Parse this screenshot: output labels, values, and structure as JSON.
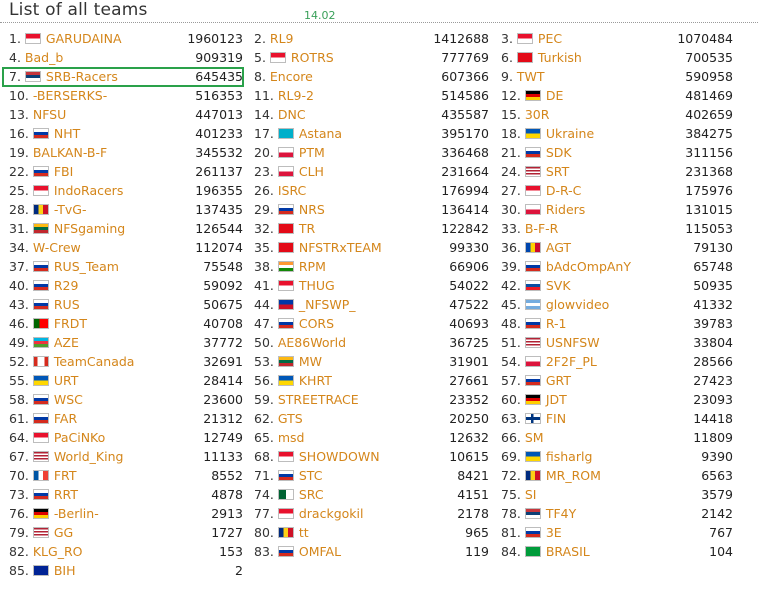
{
  "page": {
    "title": "List of all teams",
    "date": "14.02"
  },
  "colors": {
    "link": "#d4861b",
    "highlight": "#2aa14a",
    "date": "#3aa05a"
  },
  "teams": [
    {
      "rank": "1.",
      "name": "GARUDAINA",
      "score": "1960123",
      "flag": "flag-id"
    },
    {
      "rank": "2.",
      "name": "RL9",
      "score": "1412688",
      "flag": "none"
    },
    {
      "rank": "3.",
      "name": "PEC",
      "score": "1070484",
      "flag": "flag-id"
    },
    {
      "rank": "4.",
      "name": "Bad_b",
      "score": "909319",
      "flag": "none"
    },
    {
      "rank": "5.",
      "name": "ROTRS",
      "score": "777769",
      "flag": "flag-id"
    },
    {
      "rank": "6.",
      "name": "Turkish",
      "score": "700535",
      "flag": "flag-tr"
    },
    {
      "rank": "7.",
      "name": "SRB-Racers",
      "score": "645435",
      "flag": "flag-rs"
    },
    {
      "rank": "8.",
      "name": "Encore",
      "score": "607366",
      "flag": "none"
    },
    {
      "rank": "9.",
      "name": "TWT",
      "score": "590958",
      "flag": "none"
    },
    {
      "rank": "10.",
      "name": "-BERSERKS-",
      "score": "516353",
      "flag": "none"
    },
    {
      "rank": "11.",
      "name": "RL9-2",
      "score": "514586",
      "flag": "none"
    },
    {
      "rank": "12.",
      "name": "DE",
      "score": "481469",
      "flag": "flag-de"
    },
    {
      "rank": "13.",
      "name": "NFSU",
      "score": "447013",
      "flag": "none"
    },
    {
      "rank": "14.",
      "name": "DNC",
      "score": "435587",
      "flag": "none"
    },
    {
      "rank": "15.",
      "name": "30R",
      "score": "402659",
      "flag": "none"
    },
    {
      "rank": "16.",
      "name": "NHT",
      "score": "401233",
      "flag": "flag-ru"
    },
    {
      "rank": "17.",
      "name": "Astana",
      "score": "395170",
      "flag": "flag-kz"
    },
    {
      "rank": "18.",
      "name": "Ukraine",
      "score": "384275",
      "flag": "flag-ua"
    },
    {
      "rank": "19.",
      "name": "BALKAN-B-F",
      "score": "345532",
      "flag": "none"
    },
    {
      "rank": "20.",
      "name": "PTM",
      "score": "336468",
      "flag": "flag-pl"
    },
    {
      "rank": "21.",
      "name": "SDK",
      "score": "311156",
      "flag": "flag-ru"
    },
    {
      "rank": "22.",
      "name": "FBI",
      "score": "261137",
      "flag": "flag-ru"
    },
    {
      "rank": "23.",
      "name": "CLH",
      "score": "231664",
      "flag": "flag-pl"
    },
    {
      "rank": "24.",
      "name": "SRT",
      "score": "231368",
      "flag": "flag-us"
    },
    {
      "rank": "25.",
      "name": "IndoRacers",
      "score": "196355",
      "flag": "flag-id"
    },
    {
      "rank": "26.",
      "name": "ISRC",
      "score": "176994",
      "flag": "none"
    },
    {
      "rank": "27.",
      "name": "D-R-C",
      "score": "175976",
      "flag": "flag-id"
    },
    {
      "rank": "28.",
      "name": "-TvG-",
      "score": "137435",
      "flag": "flag-ro"
    },
    {
      "rank": "29.",
      "name": "NRS",
      "score": "136414",
      "flag": "flag-ru"
    },
    {
      "rank": "30.",
      "name": "Riders",
      "score": "131015",
      "flag": "flag-pl"
    },
    {
      "rank": "31.",
      "name": "NFSgaming",
      "score": "126544",
      "flag": "flag-lt"
    },
    {
      "rank": "32.",
      "name": "TR",
      "score": "122842",
      "flag": "flag-tr"
    },
    {
      "rank": "33.",
      "name": "B-F-R",
      "score": "115053",
      "flag": "none"
    },
    {
      "rank": "34.",
      "name": "W-Crew",
      "score": "112074",
      "flag": "none"
    },
    {
      "rank": "35.",
      "name": "NFSTRxTEAM",
      "score": "99330",
      "flag": "flag-tr"
    },
    {
      "rank": "36.",
      "name": "AGT",
      "score": "79130",
      "flag": "flag-md"
    },
    {
      "rank": "37.",
      "name": "RUS_Team",
      "score": "75548",
      "flag": "flag-ru"
    },
    {
      "rank": "38.",
      "name": "RPM",
      "score": "66906",
      "flag": "flag-in"
    },
    {
      "rank": "39.",
      "name": "bAdcOmpAnY",
      "score": "65748",
      "flag": "flag-ru"
    },
    {
      "rank": "40.",
      "name": "R29",
      "score": "59092",
      "flag": "flag-ru"
    },
    {
      "rank": "41.",
      "name": "THUG",
      "score": "54022",
      "flag": "flag-id"
    },
    {
      "rank": "42.",
      "name": "SVK",
      "score": "50935",
      "flag": "flag-sk"
    },
    {
      "rank": "43.",
      "name": "RUS",
      "score": "50675",
      "flag": "flag-ru"
    },
    {
      "rank": "44.",
      "name": "_NFSWP_",
      "score": "47522",
      "flag": "flag-ph"
    },
    {
      "rank": "45.",
      "name": "glowvideo",
      "score": "41332",
      "flag": "flag-ar"
    },
    {
      "rank": "46.",
      "name": "FRDT",
      "score": "40708",
      "flag": "flag-pt"
    },
    {
      "rank": "47.",
      "name": "CORS",
      "score": "40693",
      "flag": "flag-ru"
    },
    {
      "rank": "48.",
      "name": "R-1",
      "score": "39783",
      "flag": "flag-ru"
    },
    {
      "rank": "49.",
      "name": "AZE",
      "score": "37772",
      "flag": "flag-az"
    },
    {
      "rank": "50.",
      "name": "AE86World",
      "score": "36725",
      "flag": "none"
    },
    {
      "rank": "51.",
      "name": "USNFSW",
      "score": "33804",
      "flag": "flag-us"
    },
    {
      "rank": "52.",
      "name": "TeamCanada",
      "score": "32691",
      "flag": "flag-ca"
    },
    {
      "rank": "53.",
      "name": "MW",
      "score": "31901",
      "flag": "flag-lt"
    },
    {
      "rank": "54.",
      "name": "2F2F_PL",
      "score": "28566",
      "flag": "flag-pl"
    },
    {
      "rank": "55.",
      "name": "URT",
      "score": "28414",
      "flag": "flag-ua"
    },
    {
      "rank": "56.",
      "name": "KHRT",
      "score": "27661",
      "flag": "flag-ua"
    },
    {
      "rank": "57.",
      "name": "GRT",
      "score": "27423",
      "flag": "flag-ru"
    },
    {
      "rank": "58.",
      "name": "WSC",
      "score": "23600",
      "flag": "flag-ru"
    },
    {
      "rank": "59.",
      "name": "STREETRACE",
      "score": "23352",
      "flag": "none"
    },
    {
      "rank": "60.",
      "name": "JDT",
      "score": "23093",
      "flag": "flag-de"
    },
    {
      "rank": "61.",
      "name": "FAR",
      "score": "21312",
      "flag": "flag-ru"
    },
    {
      "rank": "62.",
      "name": "GTS",
      "score": "20250",
      "flag": "none"
    },
    {
      "rank": "63.",
      "name": "FIN",
      "score": "14418",
      "flag": "flag-fi"
    },
    {
      "rank": "64.",
      "name": "PaCiNKo",
      "score": "12749",
      "flag": "flag-id"
    },
    {
      "rank": "65.",
      "name": "msd",
      "score": "12632",
      "flag": "none"
    },
    {
      "rank": "66.",
      "name": "SM",
      "score": "11809",
      "flag": "none"
    },
    {
      "rank": "67.",
      "name": "World_King",
      "score": "11133",
      "flag": "flag-us"
    },
    {
      "rank": "68.",
      "name": "SHOWDOWN",
      "score": "10615",
      "flag": "flag-id"
    },
    {
      "rank": "69.",
      "name": "fisharlg",
      "score": "9390",
      "flag": "flag-ua"
    },
    {
      "rank": "70.",
      "name": "FRT",
      "score": "8552",
      "flag": "flag-fr"
    },
    {
      "rank": "71.",
      "name": "STC",
      "score": "8421",
      "flag": "flag-ru"
    },
    {
      "rank": "72.",
      "name": "MR_ROM",
      "score": "6563",
      "flag": "flag-ro"
    },
    {
      "rank": "73.",
      "name": "RRT",
      "score": "4878",
      "flag": "flag-ru"
    },
    {
      "rank": "74.",
      "name": "SRC",
      "score": "4151",
      "flag": "flag-dz"
    },
    {
      "rank": "75.",
      "name": "SI",
      "score": "3579",
      "flag": "none"
    },
    {
      "rank": "76.",
      "name": "-Berlin-",
      "score": "2913",
      "flag": "flag-de"
    },
    {
      "rank": "77.",
      "name": "drackgokil",
      "score": "2178",
      "flag": "flag-id"
    },
    {
      "rank": "78.",
      "name": "TF4Y",
      "score": "2142",
      "flag": "flag-rs"
    },
    {
      "rank": "79.",
      "name": "GG",
      "score": "1727",
      "flag": "flag-us"
    },
    {
      "rank": "80.",
      "name": "tt",
      "score": "965",
      "flag": "flag-ro"
    },
    {
      "rank": "81.",
      "name": "3E",
      "score": "767",
      "flag": "flag-ru"
    },
    {
      "rank": "82.",
      "name": "KLG_RO",
      "score": "153",
      "flag": "none"
    },
    {
      "rank": "83.",
      "name": "OMFAL",
      "score": "119",
      "flag": "flag-ru"
    },
    {
      "rank": "84.",
      "name": "BRASIL",
      "score": "104",
      "flag": "flag-br"
    },
    {
      "rank": "85.",
      "name": "BIH",
      "score": "2",
      "flag": "flag-ba"
    }
  ]
}
